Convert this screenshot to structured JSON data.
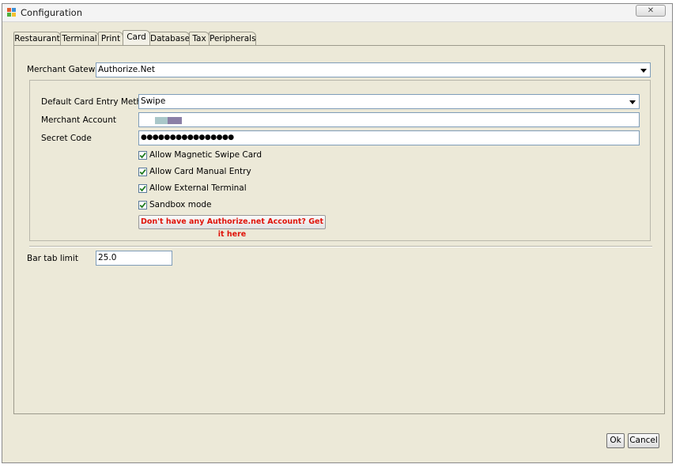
{
  "window": {
    "title": "Configuration",
    "close_label": "✕"
  },
  "tabs": [
    {
      "label": "Restaurant",
      "active": false
    },
    {
      "label": "Terminal",
      "active": false
    },
    {
      "label": "Print",
      "active": false
    },
    {
      "label": "Card",
      "active": true
    },
    {
      "label": "Database",
      "active": false
    },
    {
      "label": "Tax",
      "active": false
    },
    {
      "label": "Peripherals",
      "active": false
    }
  ],
  "card": {
    "merchant_gateway_label": "Merchant Gateway",
    "merchant_gateway_value": "Authorize.Net",
    "entry_method_label": "Default Card Entry Method",
    "entry_method_value": "Swipe",
    "merchant_account_label": "Merchant Account",
    "merchant_account_value": "",
    "secret_code_label": "Secret Code",
    "secret_code_value": "●●●●●●●●●●●●●●●●",
    "options": [
      {
        "label": "Allow Magnetic Swipe Card",
        "checked": true
      },
      {
        "label": "Allow Card Manual Entry",
        "checked": true
      },
      {
        "label": "Allow External Terminal",
        "checked": true
      },
      {
        "label": "Sandbox mode",
        "checked": true
      }
    ],
    "signup_link_label": "Don't have any Authorize.net Account? Get it here",
    "bar_tab_limit_label": "Bar tab limit",
    "bar_tab_limit_value": "25.0"
  },
  "buttons": {
    "ok_label": "Ok",
    "cancel_label": "Cancel"
  },
  "colors": {
    "window_bg": "#ece9d8",
    "link_red": "#e0140a",
    "check_green": "#1e7a1e",
    "field_border": "#7f9db9"
  },
  "icons": {
    "app": "app-grid-icon",
    "close": "close-icon",
    "dropdown": "chevron-down-icon",
    "check": "checkmark-icon"
  }
}
